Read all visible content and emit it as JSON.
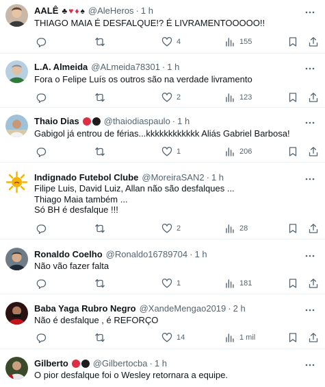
{
  "tweets": [
    {
      "name": "AALÊ",
      "badges": [
        "♣",
        "♥",
        "♦",
        "♠"
      ],
      "handle": "@AleHeros",
      "time": "1 h",
      "lines": [
        "THIAGO MAIA É DESFALQUE!? É LIVRAMENTOOOOO!!"
      ],
      "replies": "",
      "retweets": "",
      "likes": "4",
      "views": "155"
    },
    {
      "name": "L.A. Almeida",
      "badges": [],
      "handle": "@ALmeida78301",
      "time": "1 h",
      "lines": [
        "Fora o Felipe Luís os outros são na verdade livramento"
      ],
      "replies": "",
      "retweets": "",
      "likes": "2",
      "views": "123"
    },
    {
      "name": "Thaio Dias",
      "badges": [
        "red",
        "black"
      ],
      "handle": "@thaiodiaspaulo",
      "time": "1 h",
      "lines": [
        "Gabigol já entrou de férias...kkkkkkkkkkkk  Aliás Gabriel Barbosa!"
      ],
      "replies": "",
      "retweets": "",
      "likes": "1",
      "views": "206"
    },
    {
      "name": "Indignado Futebol Clube",
      "badges": [],
      "handle": "@MoreiraSAN2",
      "time": "1 h",
      "lines": [
        "Filipe Luis, David Luiz, Allan não são desfalques ...",
        "Thiago Maia também ...",
        "Só BH é desfalque !!!"
      ],
      "replies": "",
      "retweets": "",
      "likes": "2",
      "views": "28"
    },
    {
      "name": "Ronaldo Coelho",
      "badges": [],
      "handle": "@Ronaldo16789704",
      "time": "1 h",
      "lines": [
        "Não vão fazer falta"
      ],
      "replies": "",
      "retweets": "",
      "likes": "1",
      "views": "181"
    },
    {
      "name": "Baba Yaga Rubro Negro",
      "badges": [],
      "handle": "@XandeMengao2019",
      "time": "2 h",
      "lines": [
        "Não é desfalque , é REFORÇO"
      ],
      "replies": "",
      "retweets": "",
      "likes": "14",
      "views": "1 mil"
    },
    {
      "name": "Gilberto",
      "badges": [
        "red",
        "black"
      ],
      "handle": "@Gilbertocba",
      "time": "1 h",
      "lines": [
        "O pior desfalque foi o Wesley retornara a equipe."
      ],
      "replies": "",
      "retweets": "",
      "likes": "",
      "views": ""
    }
  ],
  "separator": "·",
  "colors": {
    "text": "#0f1419",
    "secondary": "#536471",
    "divider": "#eff3f4",
    "red": "#dd2e44"
  },
  "icons": {
    "reply": "reply-icon",
    "retweet": "retweet-icon",
    "like": "heart-icon",
    "views": "views-icon",
    "bookmark": "bookmark-icon",
    "share": "share-icon",
    "more": "more-icon"
  }
}
